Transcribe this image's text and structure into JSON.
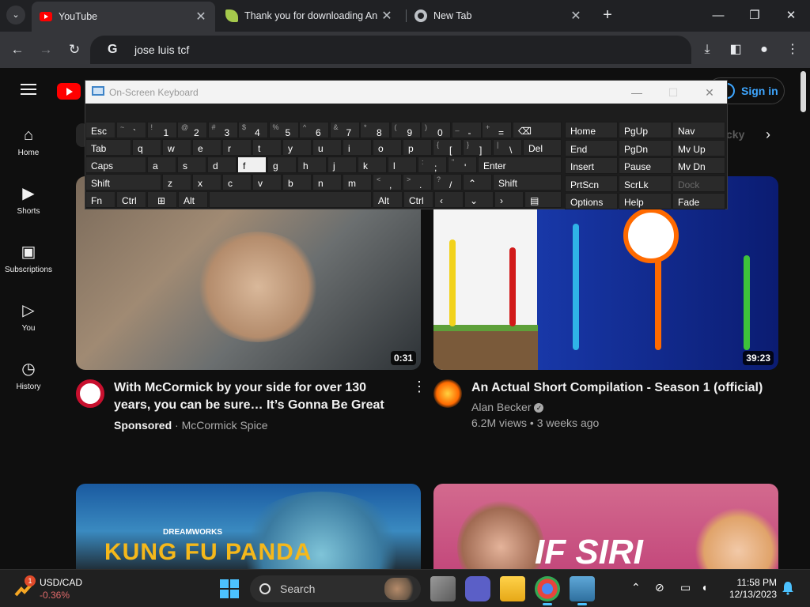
{
  "browser": {
    "tabs": [
      {
        "title": "YouTube",
        "active": true
      },
      {
        "title": "Thank you for downloading An",
        "active": false
      },
      {
        "title": "New Tab",
        "active": false
      }
    ],
    "close_glyph": "✕",
    "new_tab_glyph": "+",
    "omnibox": {
      "text": "jose luis tcf",
      "search_glyph": "G"
    }
  },
  "youtube": {
    "signin_label": "Sign in",
    "sidebar": [
      {
        "label": "Home",
        "icon": "home-icon"
      },
      {
        "label": "Shorts",
        "icon": "shorts-icon"
      },
      {
        "label": "Subscriptions",
        "icon": "subscriptions-icon"
      },
      {
        "label": "You",
        "icon": "you-icon"
      },
      {
        "label": "History",
        "icon": "history-icon"
      }
    ],
    "chip_fragment": "cky",
    "videos": [
      {
        "title": "With McCormick by your side for over 130 years, you can be sure… It’s Gonna Be Great",
        "sponsored": "Sponsored",
        "channel": "McCormick Spice",
        "duration": "0:31"
      },
      {
        "title": "An Actual Short Compilation - Season 1 (official)",
        "channel": "Alan Becker",
        "stats": "6.2M views • 3 weeks ago",
        "duration": "39:23"
      },
      {
        "thumb_text": "KUNG FU PANDA",
        "thumb_brand": "DREAMWORKS"
      },
      {
        "thumb_text": "IF SIRI"
      }
    ]
  },
  "osk": {
    "title": "On-Screen Keyboard",
    "row1": [
      {
        "s": "~",
        "p": "`"
      },
      {
        "s": "!",
        "p": "1"
      },
      {
        "s": "@",
        "p": "2"
      },
      {
        "s": "#",
        "p": "3"
      },
      {
        "s": "$",
        "p": "4"
      },
      {
        "s": "%",
        "p": "5"
      },
      {
        "s": "^",
        "p": "6"
      },
      {
        "s": "&",
        "p": "7"
      },
      {
        "s": "*",
        "p": "8"
      },
      {
        "s": "(",
        "p": "9"
      },
      {
        "s": ")",
        "p": "0"
      },
      {
        "s": "_",
        "p": "-"
      },
      {
        "s": "+",
        "p": "="
      }
    ],
    "row2": [
      "q",
      "w",
      "e",
      "r",
      "t",
      "y",
      "u",
      "i",
      "o",
      "p"
    ],
    "row2_sym": [
      {
        "s": "{",
        "p": "["
      },
      {
        "s": "}",
        "p": "]"
      },
      {
        "s": "|",
        "p": "\\"
      }
    ],
    "row3": [
      "a",
      "s",
      "d",
      "f",
      "g",
      "h",
      "j",
      "k",
      "l"
    ],
    "row3_sym": [
      {
        "s": ":",
        "p": ";"
      },
      {
        "s": "\"",
        "p": "'"
      }
    ],
    "row4": [
      "z",
      "x",
      "c",
      "v",
      "b",
      "n",
      "m"
    ],
    "row4_sym": [
      {
        "s": "<",
        "p": ","
      },
      {
        "s": ">",
        "p": "."
      },
      {
        "s": "?",
        "p": "/"
      }
    ],
    "labels": {
      "esc": "Esc",
      "tab": "Tab",
      "caps": "Caps",
      "shift": "Shift",
      "fn": "Fn",
      "ctrl": "Ctrl",
      "alt": "Alt",
      "del": "Del",
      "enter": "Enter",
      "backspace_glyph": "⌫",
      "up": "⌃",
      "down": "⌄",
      "left": "‹",
      "right": "›",
      "menu_glyph": "▤"
    },
    "side_keys": [
      [
        "Home",
        "PgUp",
        "Nav"
      ],
      [
        "End",
        "PgDn",
        "Mv Up"
      ],
      [
        "Insert",
        "Pause",
        "Mv Dn"
      ],
      [
        "PrtScn",
        "ScrLk",
        "Dock"
      ],
      [
        "Options",
        "Help",
        "Fade"
      ]
    ],
    "highlighted_key": "f"
  },
  "taskbar": {
    "ticker": "USD/CAD",
    "ticker_change": "-0.36%",
    "weather_badge": "1",
    "search_label": "Search",
    "time": "11:58 PM",
    "date": "12/13/2023"
  }
}
